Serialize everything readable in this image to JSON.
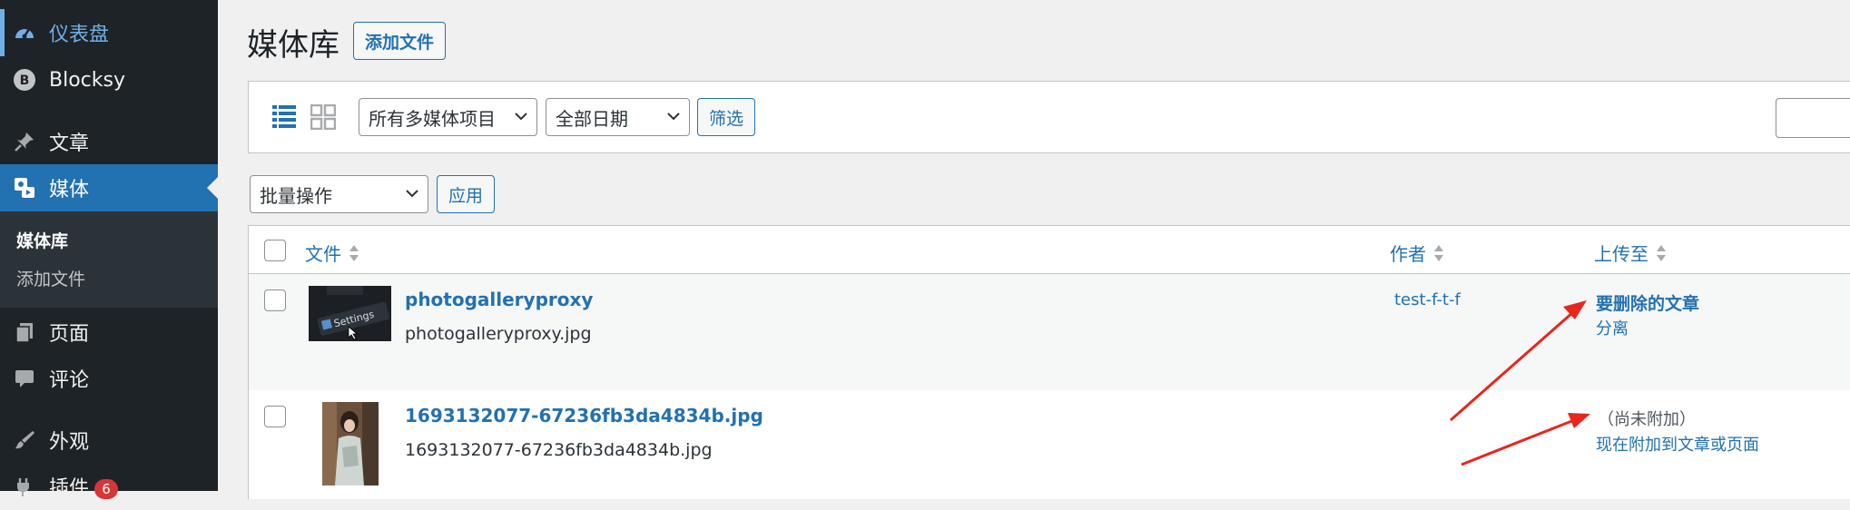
{
  "sidebar": {
    "items": [
      {
        "label": "仪表盘",
        "icon": "dashboard-icon"
      },
      {
        "label": "Blocksy",
        "icon": "blocksy-icon"
      },
      {
        "label": "文章",
        "icon": "pin-icon"
      },
      {
        "label": "媒体",
        "icon": "media-icon"
      },
      {
        "label": "页面",
        "icon": "pages-icon"
      },
      {
        "label": "评论",
        "icon": "comments-icon"
      },
      {
        "label": "外观",
        "icon": "brush-icon"
      },
      {
        "label": "插件",
        "icon": "plugin-icon",
        "badge": "6"
      }
    ],
    "submenu": [
      {
        "label": "媒体库"
      },
      {
        "label": "添加文件"
      }
    ],
    "colors": {
      "bg": "#1d2327",
      "active": "#2271b1",
      "highlight": "#72aee6"
    }
  },
  "header": {
    "title": "媒体库",
    "add_button": "添加文件"
  },
  "filters": {
    "type_select": "所有多媒体项目",
    "date_select": "全部日期",
    "filter_button": "筛选"
  },
  "bulk": {
    "select": "批量操作",
    "apply_button": "应用"
  },
  "table": {
    "columns": [
      "文件",
      "作者",
      "上传至"
    ],
    "rows": [
      {
        "title": "photogalleryproxy",
        "filename": "photogalleryproxy.jpg",
        "author": "test-f-t-f",
        "uploaded_to": "要删除的文章",
        "action": "分离",
        "thumb_text": "Settings"
      },
      {
        "title": "1693132077-67236fb3da4834b.jpg",
        "filename": "1693132077-67236fb3da4834b.jpg",
        "author": "",
        "uploaded_to": "（尚未附加）",
        "action": "现在附加到文章或页面"
      }
    ]
  },
  "annotation_color": "#e8261b"
}
